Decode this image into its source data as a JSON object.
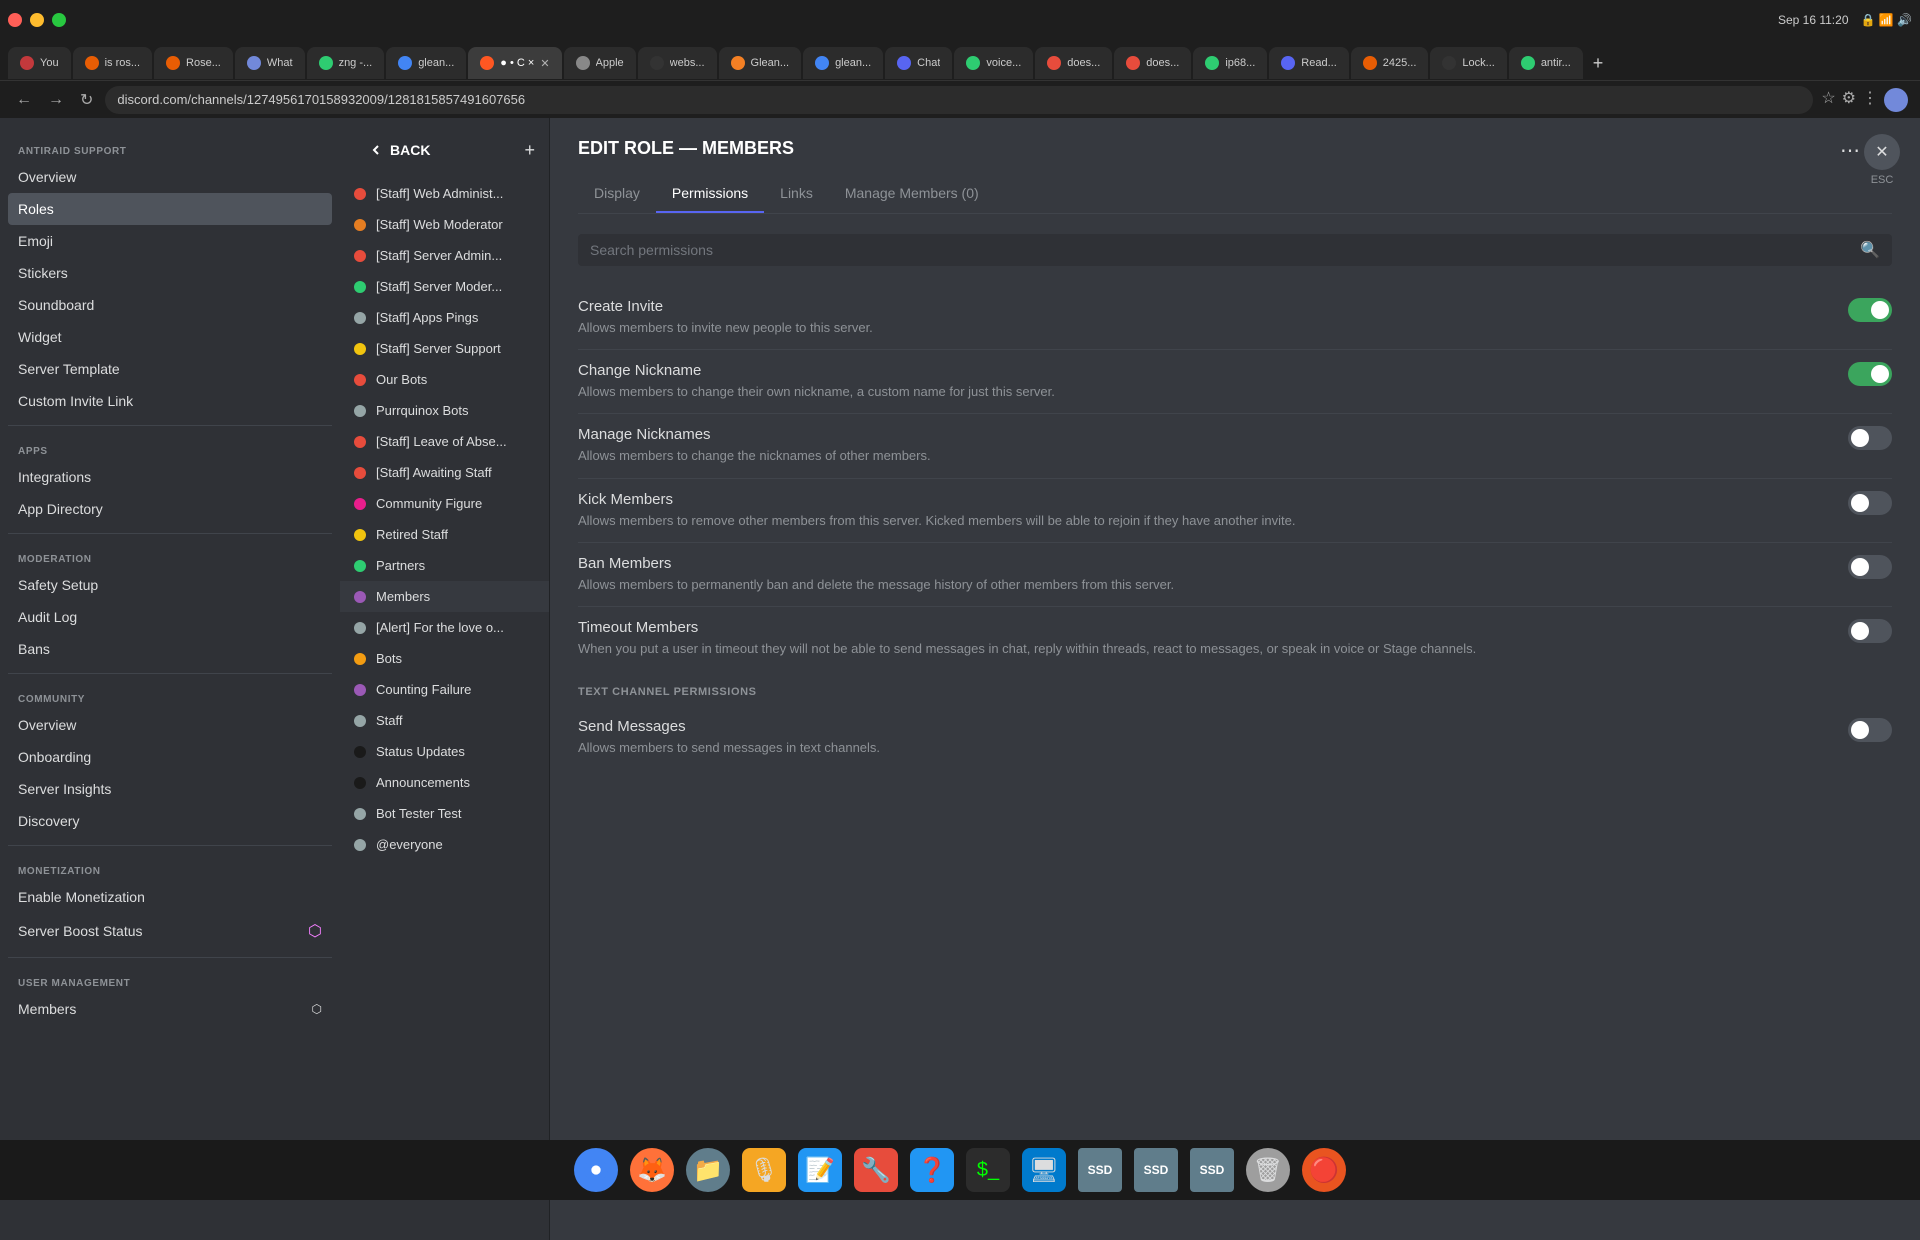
{
  "browser": {
    "datetime": "Sep 16  11:20",
    "address": "discord.com/channels/1274956170158932009/1281815857491607656",
    "tabs": [
      {
        "label": "You",
        "favicon_color": "#c3393c",
        "active": false
      },
      {
        "label": "is ros...",
        "favicon_color": "#e85d04",
        "active": false
      },
      {
        "label": "Rose...",
        "favicon_color": "#e85d04",
        "active": false
      },
      {
        "label": "What",
        "favicon_color": "#7289da",
        "active": false
      },
      {
        "label": "zng -...",
        "favicon_color": "#2ecc71",
        "active": false
      },
      {
        "label": "glean...",
        "favicon_color": "#4285f4",
        "active": false
      },
      {
        "label": "● • C ×",
        "favicon_color": "#ff5722",
        "active": true
      },
      {
        "label": "Apple",
        "favicon_color": "#888",
        "active": false
      },
      {
        "label": "webs...",
        "favicon_color": "#333",
        "active": false
      },
      {
        "label": "Glean...",
        "favicon_color": "#f48024",
        "active": false
      },
      {
        "label": "glean...",
        "favicon_color": "#4285f4",
        "active": false
      },
      {
        "label": "Chat",
        "favicon_color": "#5865f2",
        "active": false
      },
      {
        "label": "voice...",
        "favicon_color": "#2ecc71",
        "active": false
      },
      {
        "label": "does...",
        "favicon_color": "#e74c3c",
        "active": false
      },
      {
        "label": "does...",
        "favicon_color": "#e74c3c",
        "active": false
      },
      {
        "label": "ip68...",
        "favicon_color": "#2ecc71",
        "active": false
      },
      {
        "label": "Read...",
        "favicon_color": "#7289da",
        "active": false
      },
      {
        "label": "2425...",
        "favicon_color": "#e85d04",
        "active": false
      },
      {
        "label": "Lock...",
        "favicon_color": "#666",
        "active": false
      },
      {
        "label": "antir...",
        "favicon_color": "#2ecc71",
        "active": false
      }
    ]
  },
  "settings_nav": {
    "back_btn": "BACK",
    "add_icon": "+",
    "sections": [
      {
        "header": null,
        "items": [
          {
            "label": "Overview",
            "active": false
          },
          {
            "label": "Roles",
            "active": true
          },
          {
            "label": "Emoji",
            "active": false
          },
          {
            "label": "Stickers",
            "active": false
          },
          {
            "label": "Soundboard",
            "active": false
          },
          {
            "label": "Widget",
            "active": false
          },
          {
            "label": "Server Template",
            "active": false
          },
          {
            "label": "Custom Invite Link",
            "active": false
          }
        ]
      },
      {
        "header": "APPS",
        "items": [
          {
            "label": "Integrations",
            "active": false
          },
          {
            "label": "App Directory",
            "active": false
          }
        ]
      },
      {
        "header": "MODERATION",
        "items": [
          {
            "label": "Safety Setup",
            "active": false
          },
          {
            "label": "Audit Log",
            "active": false
          },
          {
            "label": "Bans",
            "active": false
          }
        ]
      },
      {
        "header": "COMMUNITY",
        "items": [
          {
            "label": "Overview",
            "active": false
          },
          {
            "label": "Onboarding",
            "active": false
          },
          {
            "label": "Server Insights",
            "active": false
          },
          {
            "label": "Discovery",
            "active": false
          }
        ]
      },
      {
        "header": "MONETIZATION",
        "items": [
          {
            "label": "Enable Monetization",
            "active": false
          },
          {
            "label": "Server Boost Status",
            "active": false
          }
        ]
      },
      {
        "header": "USER MANAGEMENT",
        "items": [
          {
            "label": "Members",
            "active": false
          }
        ]
      }
    ]
  },
  "roles_list": {
    "items": [
      {
        "name": "[Staff] Web Administ...",
        "color": "#e74c3c",
        "active": false
      },
      {
        "name": "[Staff] Web Moderator",
        "color": "#e67e22",
        "active": false
      },
      {
        "name": "[Staff] Server Admin...",
        "color": "#e74c3c",
        "active": false
      },
      {
        "name": "[Staff] Server Moder...",
        "color": "#2ecc71",
        "active": false
      },
      {
        "name": "[Staff] Apps Pings",
        "color": "#95a5a6",
        "active": false
      },
      {
        "name": "[Staff] Server Support",
        "color": "#f1c40f",
        "active": false
      },
      {
        "name": "Our Bots",
        "color": "#e74c3c",
        "active": false
      },
      {
        "name": "Purrquinox Bots",
        "color": "#95a5a6",
        "active": false
      },
      {
        "name": "[Staff] Leave of Abse...",
        "color": "#e74c3c",
        "active": false
      },
      {
        "name": "[Staff] Awaiting Staff",
        "color": "#e74c3c",
        "active": false
      },
      {
        "name": "Community Figure",
        "color": "#e91e8c",
        "active": false
      },
      {
        "name": "Retired Staff",
        "color": "#f1c40f",
        "active": false
      },
      {
        "name": "Partners",
        "color": "#2ecc71",
        "active": false
      },
      {
        "name": "Members",
        "color": "#9b59b6",
        "active": true
      },
      {
        "name": "[Alert] For the love o...",
        "color": "#95a5a6",
        "active": false
      },
      {
        "name": "Bots",
        "color": "#f39c12",
        "active": false
      },
      {
        "name": "Counting Failure",
        "color": "#9b59b6",
        "active": false
      },
      {
        "name": "Staff",
        "color": "#95a5a6",
        "active": false
      },
      {
        "name": "Status Updates",
        "color": "#1a1a1a",
        "active": false
      },
      {
        "name": "Announcements",
        "color": "#1a1a1a",
        "active": false
      },
      {
        "name": "Bot Tester Test",
        "color": "#95a5a6",
        "active": false
      },
      {
        "name": "@everyone",
        "color": "#95a5a6",
        "active": false
      }
    ]
  },
  "edit_role": {
    "title": "EDIT ROLE — MEMBERS",
    "tabs": [
      {
        "label": "Display",
        "active": false
      },
      {
        "label": "Permissions",
        "active": true
      },
      {
        "label": "Links",
        "active": false
      },
      {
        "label": "Manage Members (0)",
        "active": false
      }
    ],
    "search_placeholder": "Search permissions",
    "permissions": [
      {
        "name": "Create Invite",
        "description": "Allows members to invite new people to this server.",
        "state": "on"
      },
      {
        "name": "Change Nickname",
        "description": "Allows members to change their own nickname, a custom name for just this server.",
        "state": "on"
      },
      {
        "name": "Manage Nicknames",
        "description": "Allows members to change the nicknames of other members.",
        "state": "off"
      },
      {
        "name": "Kick Members",
        "description": "Allows members to remove other members from this server. Kicked members will be able to rejoin if they have another invite.",
        "state": "off"
      },
      {
        "name": "Ban Members",
        "description": "Allows members to permanently ban and delete the message history of other members from this server.",
        "state": "off"
      },
      {
        "name": "Timeout Members",
        "description": "When you put a user in timeout they will not be able to send messages in chat, reply within threads, react to messages, or speak in voice or Stage channels.",
        "state": "off"
      }
    ],
    "text_channel_section": "TEXT CHANNEL PERMISSIONS",
    "text_channel_permissions": [
      {
        "name": "Send Messages",
        "description": "Allows members to send messages in text channels.",
        "state": "off"
      }
    ],
    "esc_label": "ESC"
  },
  "taskbar": {
    "icons": [
      {
        "name": "chrome",
        "color": "#4285f4"
      },
      {
        "name": "firefox",
        "color": "#ff7139"
      },
      {
        "name": "files",
        "color": "#888"
      },
      {
        "name": "gpodder",
        "color": "#f5a623"
      },
      {
        "name": "writer",
        "color": "#2196f3"
      },
      {
        "name": "app1",
        "color": "#e74c3c"
      },
      {
        "name": "help",
        "color": "#2196f3"
      },
      {
        "name": "terminal",
        "color": "#333"
      },
      {
        "name": "vscode",
        "color": "#007acc"
      },
      {
        "name": "ssd1",
        "color": "#607d8b"
      },
      {
        "name": "ssd2",
        "color": "#607d8b"
      },
      {
        "name": "ssd3",
        "color": "#607d8b"
      },
      {
        "name": "trash",
        "color": "#9e9e9e"
      },
      {
        "name": "ubuntu",
        "color": "#e95420"
      }
    ]
  }
}
